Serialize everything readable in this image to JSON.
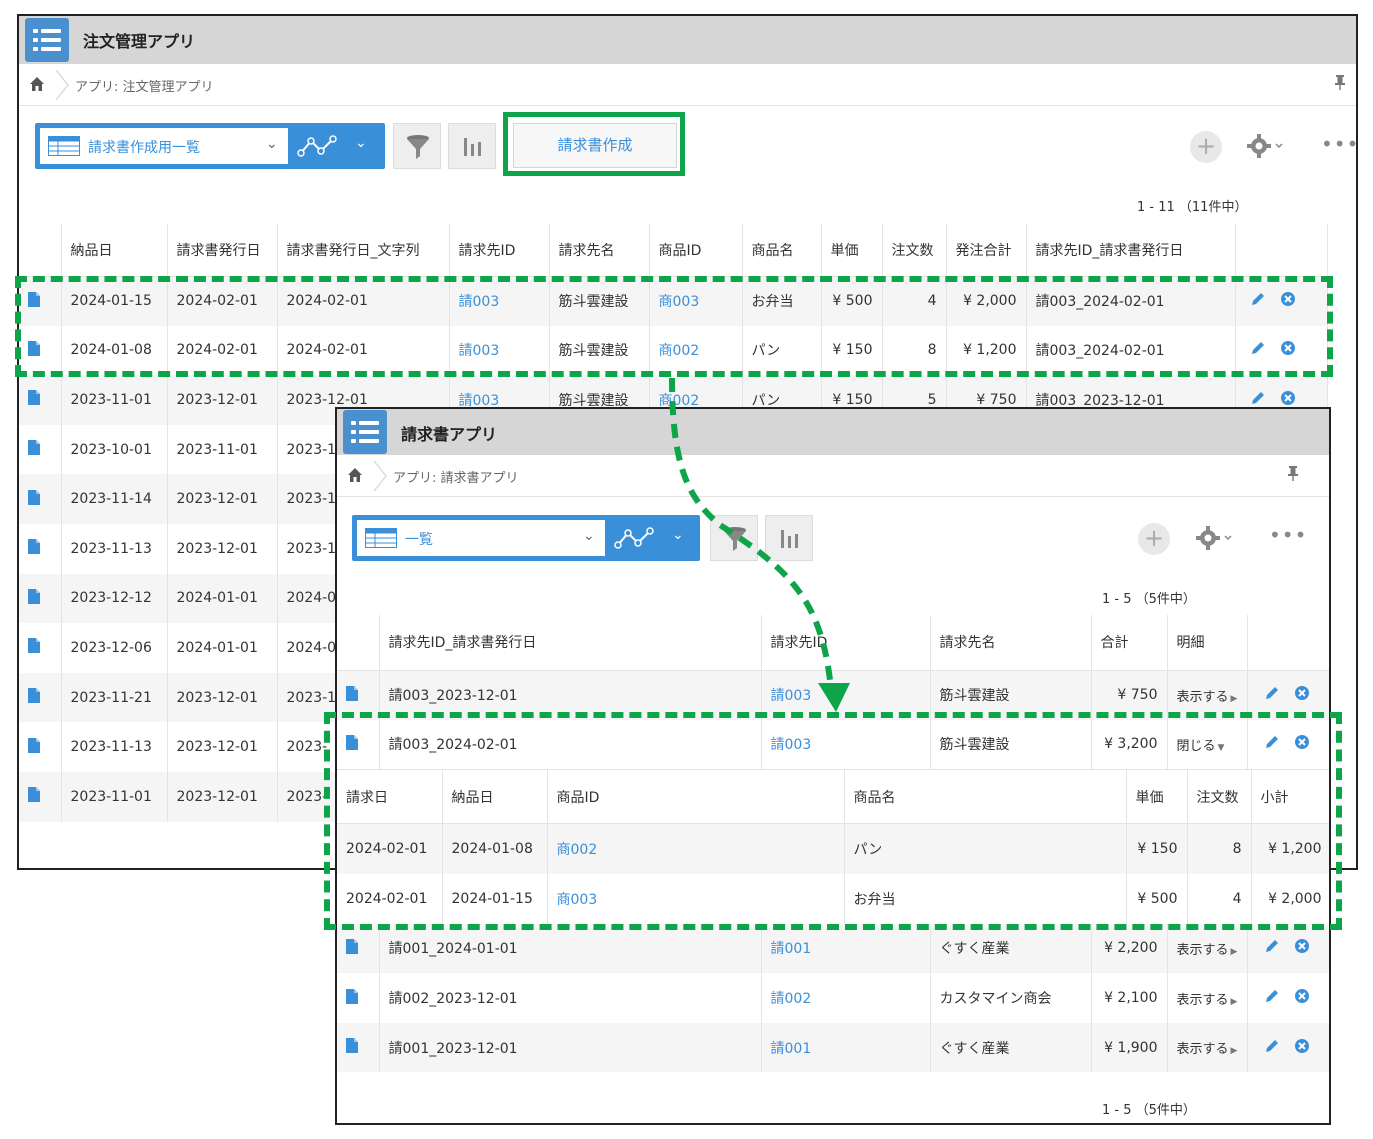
{
  "order_app": {
    "title": "注文管理アプリ",
    "breadcrumb": "アプリ: 注文管理アプリ",
    "view_name": "請求書作成用一覧",
    "create_invoice_button": "請求書作成",
    "record_count": "1 - 11 （11件中）",
    "columns": [
      "納品日",
      "請求書発行日",
      "請求書発行日_文字列",
      "請求先ID",
      "請求先名",
      "商品ID",
      "商品名",
      "単価",
      "注文数",
      "発注合計",
      "請求先ID_請求書発行日"
    ],
    "rows": [
      [
        "2024-01-15",
        "2024-02-01",
        "2024-02-01",
        "請003",
        "筋斗雲建設",
        "商003",
        "お弁当",
        "¥ 500",
        "4",
        "¥ 2,000",
        "請003_2024-02-01"
      ],
      [
        "2024-01-08",
        "2024-02-01",
        "2024-02-01",
        "請003",
        "筋斗雲建設",
        "商002",
        "パン",
        "¥ 150",
        "8",
        "¥ 1,200",
        "請003_2024-02-01"
      ],
      [
        "2023-11-01",
        "2023-12-01",
        "2023-12-01",
        "請003",
        "筋斗雲建設",
        "商002",
        "パン",
        "¥ 150",
        "5",
        "¥ 750",
        "請003_2023-12-01"
      ],
      [
        "2023-10-01",
        "2023-11-01",
        "2023-1",
        "",
        "",
        "",
        "",
        "",
        "",
        "",
        ""
      ],
      [
        "2023-11-14",
        "2023-12-01",
        "2023-1",
        "",
        "",
        "",
        "",
        "",
        "",
        "",
        ""
      ],
      [
        "2023-11-13",
        "2023-12-01",
        "2023-1",
        "",
        "",
        "",
        "",
        "",
        "",
        "",
        ""
      ],
      [
        "2023-12-12",
        "2024-01-01",
        "2024-0",
        "",
        "",
        "",
        "",
        "",
        "",
        "",
        ""
      ],
      [
        "2023-12-06",
        "2024-01-01",
        "2024-0",
        "",
        "",
        "",
        "",
        "",
        "",
        "",
        ""
      ],
      [
        "2023-11-21",
        "2023-12-01",
        "2023-1",
        "",
        "",
        "",
        "",
        "",
        "",
        "",
        ""
      ],
      [
        "2023-11-13",
        "2023-12-01",
        "2023-",
        "",
        "",
        "",
        "",
        "",
        "",
        "",
        ""
      ],
      [
        "2023-11-01",
        "2023-12-01",
        "2023-",
        "",
        "",
        "",
        "",
        "",
        "",
        "",
        ""
      ]
    ]
  },
  "invoice_app": {
    "title": "請求書アプリ",
    "breadcrumb": "アプリ: 請求書アプリ",
    "view_name": "一覧",
    "record_count": "1 - 5 （5件中）",
    "columns": [
      "請求先ID_請求書発行日",
      "請求先ID",
      "請求先名",
      "合計",
      "明細"
    ],
    "rows": [
      {
        "key": "請003_2023-12-01",
        "client_id": "請003",
        "client_name": "筋斗雲建設",
        "total": "¥ 750",
        "detail": "表示する"
      },
      {
        "key": "請003_2024-02-01",
        "client_id": "請003",
        "client_name": "筋斗雲建設",
        "total": "¥ 3,200",
        "detail": "閉じる"
      },
      {
        "key": "請001_2024-01-01",
        "client_id": "請001",
        "client_name": "ぐすく産業",
        "total": "¥ 2,200",
        "detail": "表示する"
      },
      {
        "key": "請002_2023-12-01",
        "client_id": "請002",
        "client_name": "カスタマイン商会",
        "total": "¥ 2,100",
        "detail": "表示する"
      },
      {
        "key": "請001_2023-12-01",
        "client_id": "請001",
        "client_name": "ぐすく産業",
        "total": "¥ 1,900",
        "detail": "表示する"
      }
    ],
    "detail_columns": [
      "請求日",
      "納品日",
      "商品ID",
      "商品名",
      "単価",
      "注文数",
      "小計"
    ],
    "detail_rows": [
      [
        "2024-02-01",
        "2024-01-08",
        "商002",
        "パン",
        "¥ 150",
        "8",
        "¥ 1,200"
      ],
      [
        "2024-02-01",
        "2024-01-15",
        "商003",
        "お弁当",
        "¥ 500",
        "4",
        "¥ 2,000"
      ]
    ]
  },
  "colors": {
    "accent": "#3a8fd9",
    "highlight": "#0ea44a",
    "titlebar": "#d6d6d6"
  },
  "icons": [
    "app-list-icon",
    "home-icon",
    "pin-icon",
    "grid-view-icon",
    "graph-icon",
    "filter-icon",
    "bar-chart-icon",
    "plus-icon",
    "gear-icon",
    "more-icon",
    "document-icon",
    "pencil-icon",
    "close-circle-icon"
  ]
}
